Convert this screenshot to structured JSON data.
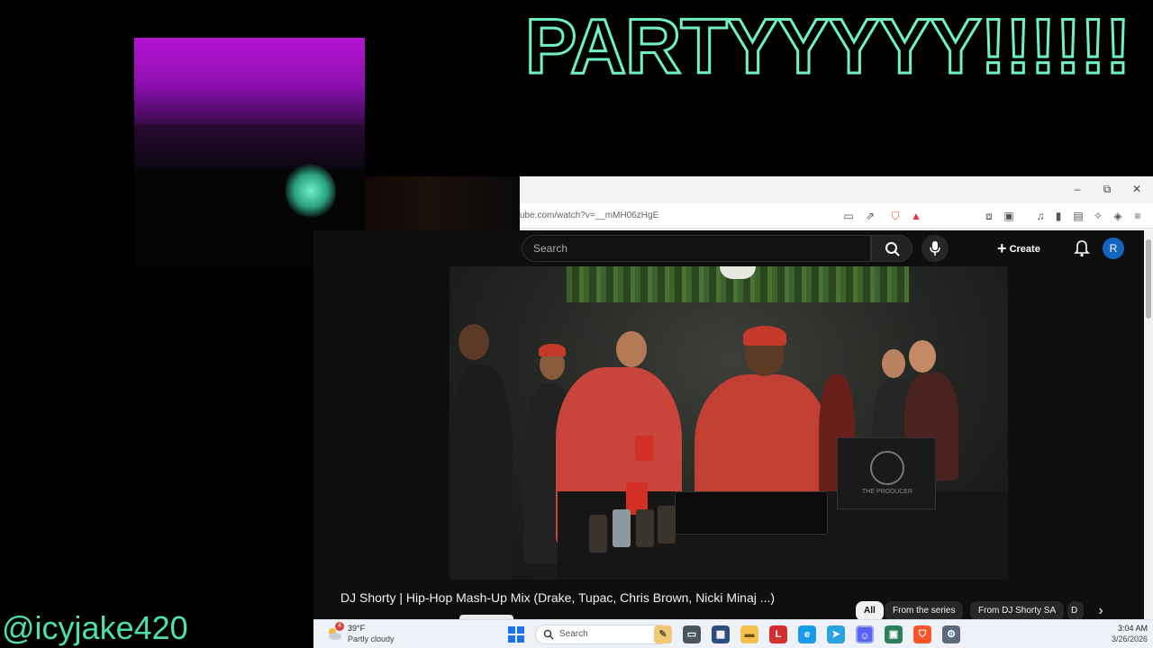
{
  "overlay": {
    "title": "PARTYYYYY!!!!!!",
    "handle": "@icyjake420"
  },
  "browser": {
    "url": "ube.com/watch?v=__mMH06zHgE",
    "window_controls": {
      "minimize": "–",
      "restore": "⧉",
      "close": "✕"
    }
  },
  "youtube": {
    "search_placeholder": "Search",
    "create_label": "Create",
    "avatar_letter": "R",
    "video_title": "DJ Shorty | Hip-Hop Mash-Up Mix (Drake, Tupac, Chris Brown, Nicki Minaj ...)",
    "laptop_text": "THE PRODUCER",
    "chips": [
      {
        "label": "All",
        "active": true
      },
      {
        "label": "From the series",
        "active": false
      },
      {
        "label": "From DJ Shorty SA",
        "active": false
      },
      {
        "label": "D",
        "active": false
      }
    ]
  },
  "taskbar": {
    "weather_badge": "4",
    "weather_temp": "39°F",
    "weather_desc": "Partly cloudy",
    "search_placeholder": "Search",
    "apps": [
      "file-explorer",
      "folder",
      "lens",
      "l-app",
      "edge",
      "telegram",
      "discord",
      "media",
      "brave",
      "settings"
    ],
    "time": "3:04 AM",
    "date": "3/26/2026"
  },
  "colors": {
    "overlay_accent": "#6ff0c8",
    "youtube_bg": "#0f0f0f",
    "avatar": "#1565c0",
    "brave": "#fb542b"
  }
}
